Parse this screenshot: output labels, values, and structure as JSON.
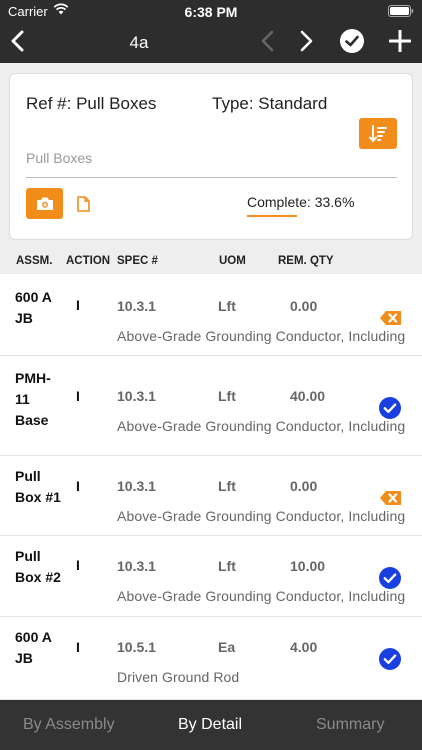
{
  "status_bar": {
    "carrier": "Carrier",
    "time": "6:38 PM"
  },
  "nav": {
    "title": "4a"
  },
  "card": {
    "ref": "Ref #: Pull Boxes",
    "type": "Type: Standard",
    "ref_field_value": "Pull Boxes",
    "complete": "Complete: 33.6%",
    "complete_fraction": 0.336
  },
  "columns": {
    "assm": "ASSM.",
    "action": "ACTION",
    "spec": "SPEC #",
    "uom": "UOM",
    "rem_qty": "REM. QTY"
  },
  "rows": [
    {
      "assm": "600 A JB",
      "action": "I",
      "spec": "10.3.1",
      "uom": "Lft",
      "qty": "0.00",
      "desc": "Above-Grade Grounding Conductor, Including",
      "status": "remove-icon"
    },
    {
      "assm": "PMH-11 Base",
      "action": "I",
      "spec": "10.3.1",
      "uom": "Lft",
      "qty": "40.00",
      "desc": "Above-Grade Grounding Conductor, Including",
      "status": "check-icon"
    },
    {
      "assm": "Pull Box #1",
      "action": "I",
      "spec": "10.3.1",
      "uom": "Lft",
      "qty": "0.00",
      "desc": "Above-Grade Grounding Conductor, Including",
      "status": "remove-icon"
    },
    {
      "assm": "Pull Box #2",
      "action": "I",
      "spec": "10.3.1",
      "uom": "Lft",
      "qty": "10.00",
      "desc": "Above-Grade Grounding Conductor, Including",
      "status": "check-icon"
    },
    {
      "assm": "600 A JB",
      "action": "I",
      "spec": "10.5.1",
      "uom": "Ea",
      "qty": "4.00",
      "desc": "Driven Ground Rod",
      "status": "check-icon"
    }
  ],
  "tabs": [
    "By Assembly",
    "By Detail",
    "Summary"
  ],
  "active_tab": "By Detail",
  "colors": {
    "accent": "#f28c1b",
    "check": "#1a3fe0",
    "nav_bg": "#2d2d2d",
    "tab_bg": "#333333",
    "tab_inactive": "#8a8a8a"
  }
}
